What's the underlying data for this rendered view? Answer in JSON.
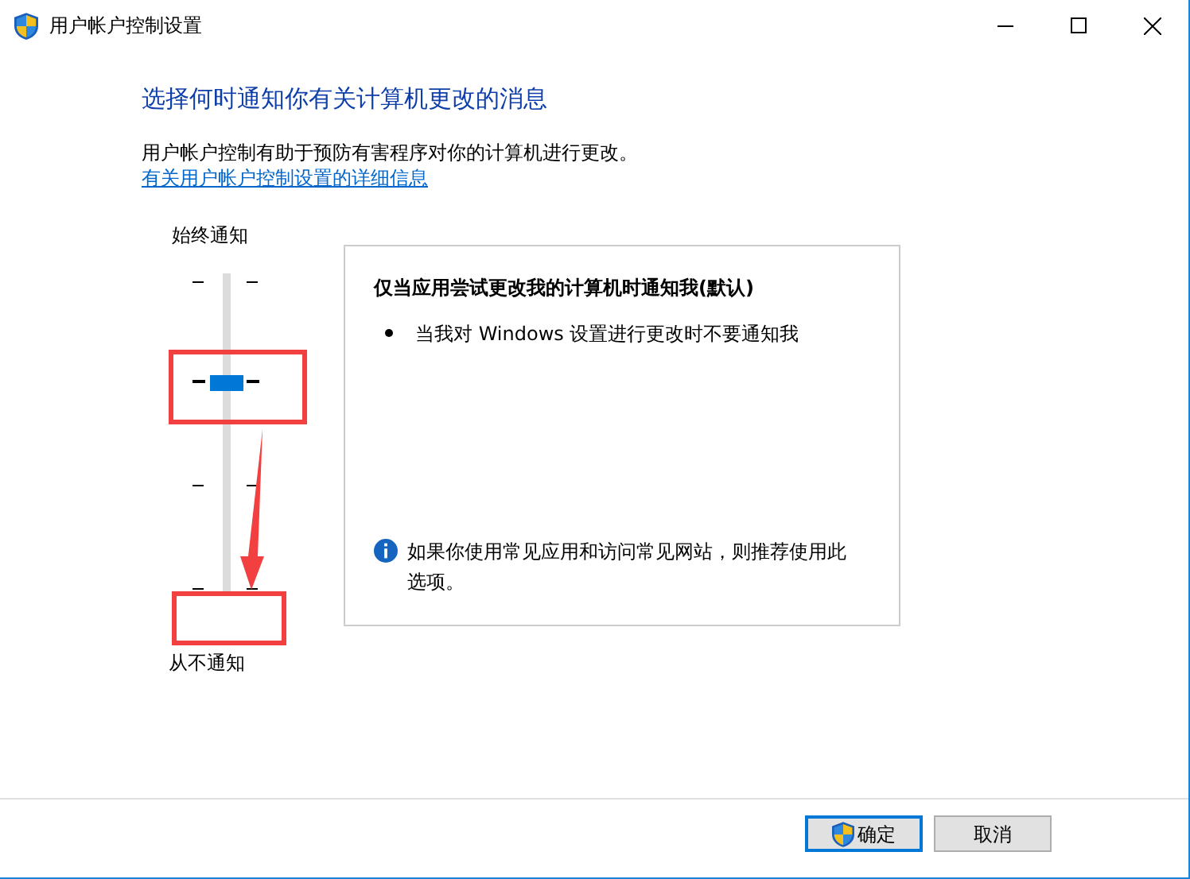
{
  "window": {
    "title": "用户帐户控制设置"
  },
  "heading": "选择何时通知你有关计算机更改的消息",
  "description": "用户帐户控制有助于预防有害程序对你的计算机进行更改。",
  "link": "有关用户帐户控制设置的详细信息",
  "slider": {
    "top_label": "始终通知",
    "bottom_label": "从不通知",
    "level": 0.667
  },
  "panel": {
    "title": "仅当应用尝试更改我的计算机时通知我(默认)",
    "bullets": [
      "当我对 Windows 设置进行更改时不要通知我"
    ],
    "info": "如果你使用常见应用和访问常见网站，则推荐使用此选项。"
  },
  "buttons": [
    {
      "label": "确定",
      "shield": true,
      "focused": true
    },
    {
      "label": "取消",
      "shield": false,
      "focused": false
    }
  ]
}
